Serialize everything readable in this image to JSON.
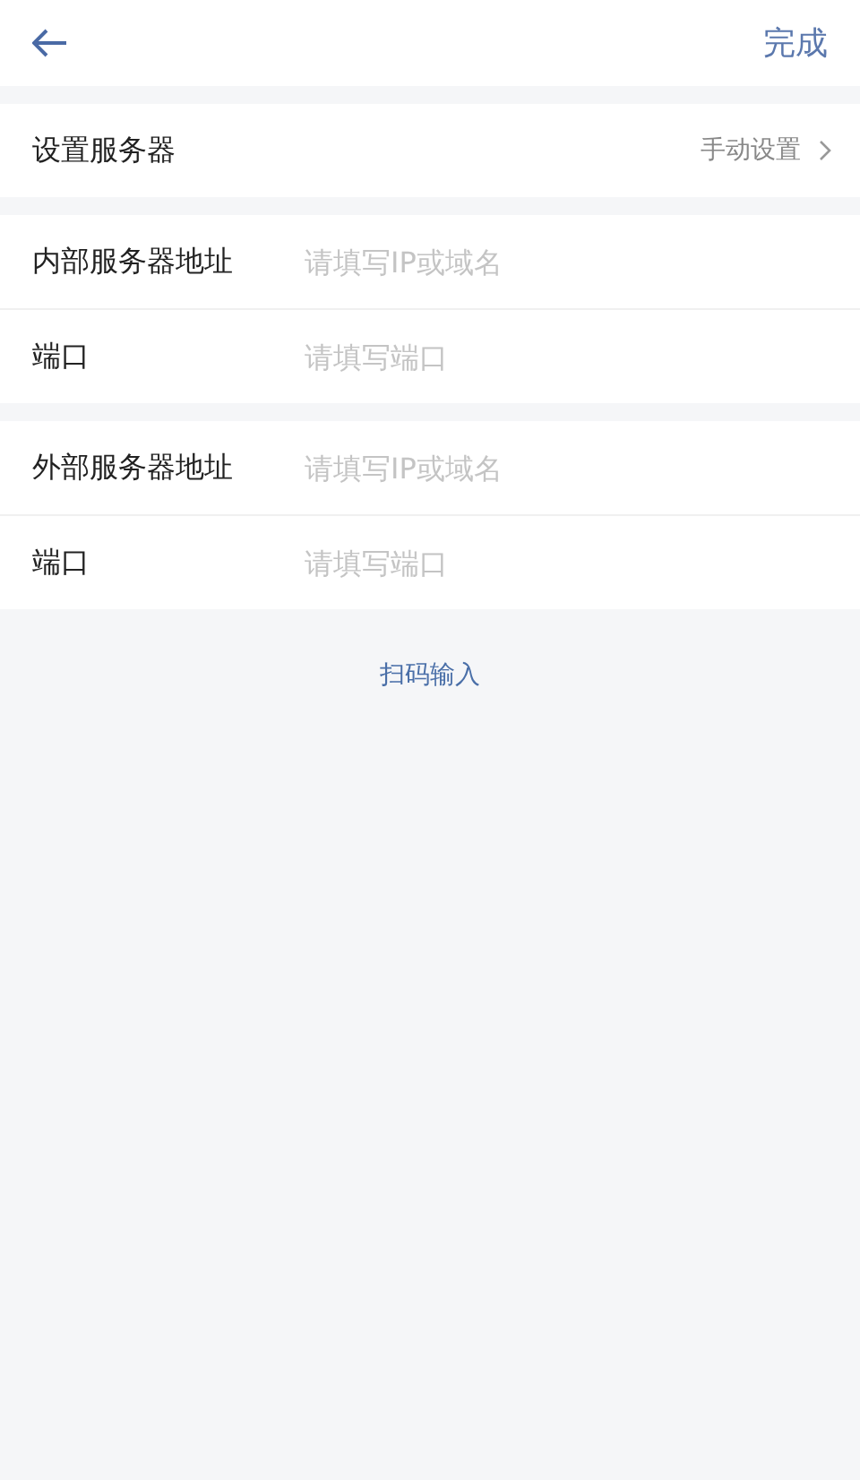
{
  "header": {
    "done": "完成"
  },
  "server_setting": {
    "label": "设置服务器",
    "value": "手动设置"
  },
  "groups": [
    {
      "rows": [
        {
          "label": "内部服务器地址",
          "placeholder": "请填写IP或域名"
        },
        {
          "label": "端口",
          "placeholder": "请填写端口"
        }
      ]
    },
    {
      "rows": [
        {
          "label": "外部服务器地址",
          "placeholder": "请填写IP或域名"
        },
        {
          "label": "端口",
          "placeholder": "请填写端口"
        }
      ]
    }
  ],
  "scan_link": "扫码输入"
}
